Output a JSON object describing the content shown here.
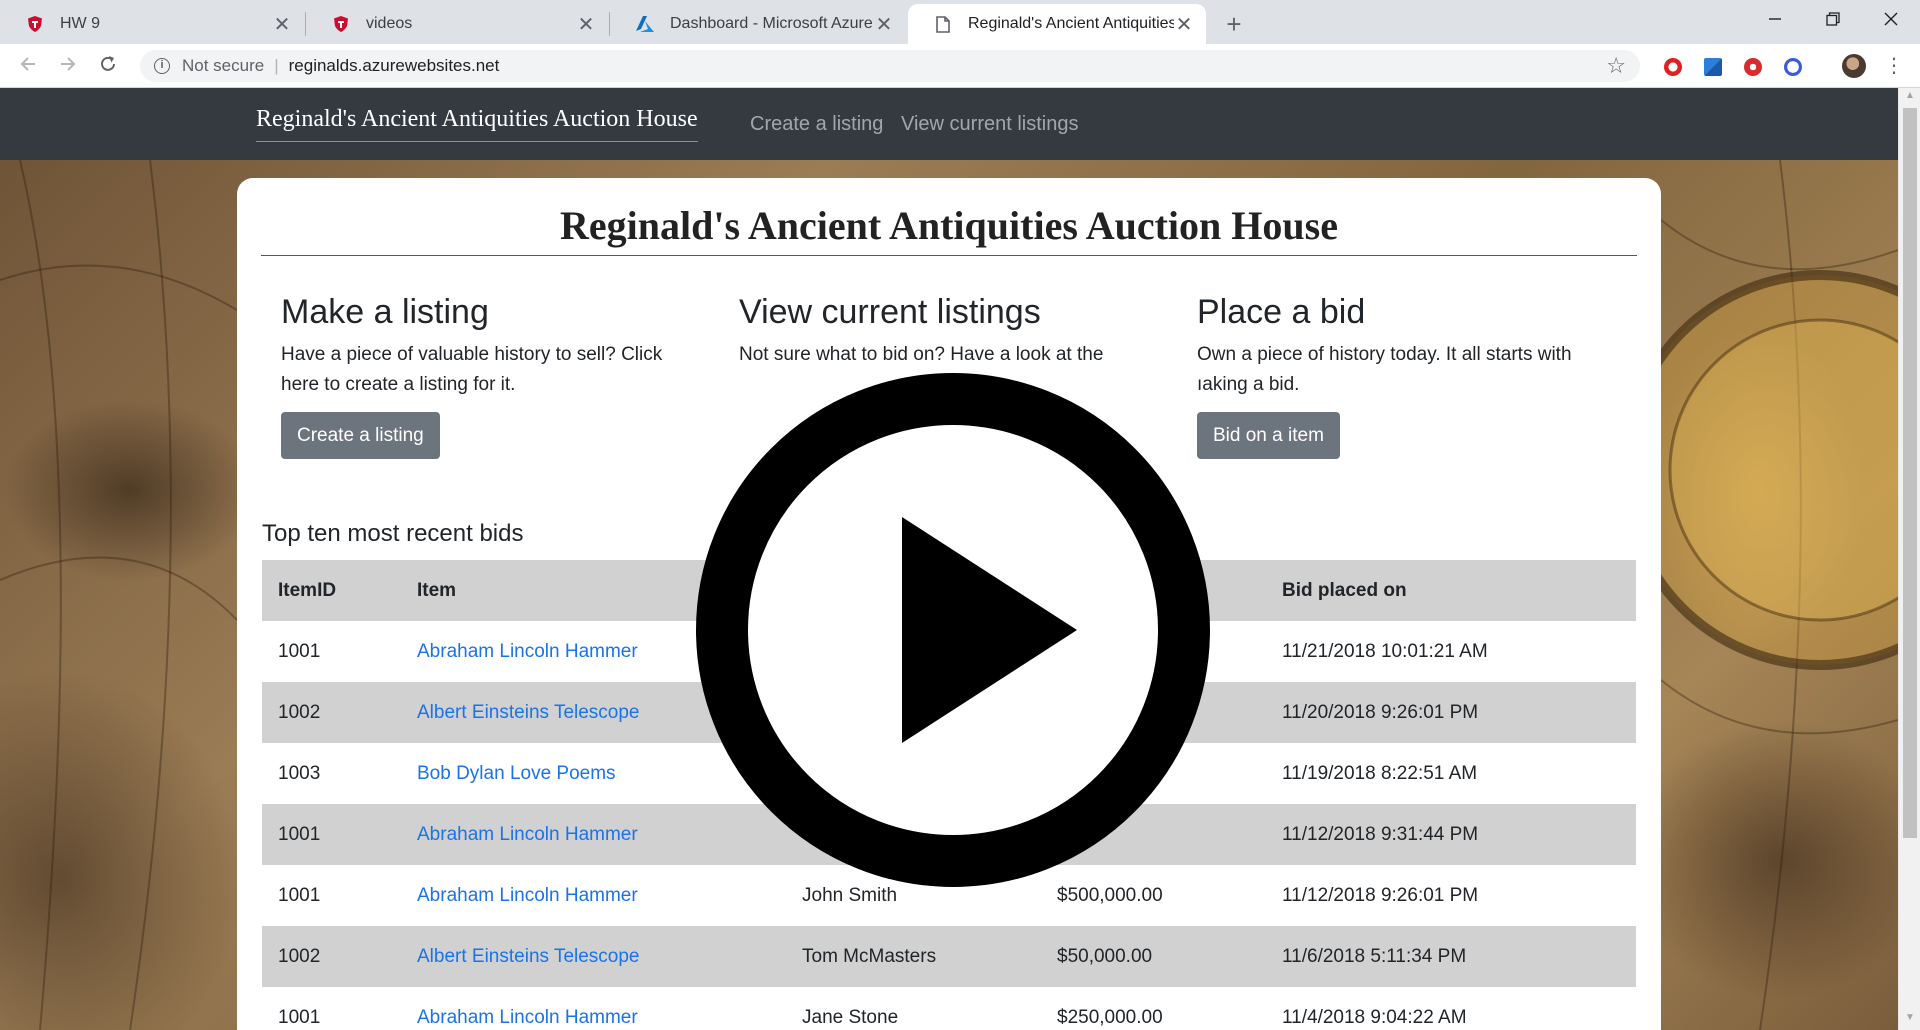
{
  "browser": {
    "tabs": [
      {
        "title": "HW 9",
        "favicon": "shield-icon",
        "active": false
      },
      {
        "title": "videos",
        "favicon": "shield-icon",
        "active": false
      },
      {
        "title": "Dashboard - Microsoft Azure",
        "favicon": "azure-icon",
        "active": false
      },
      {
        "title": "Reginald's Ancient Antiquities Au",
        "favicon": "page-icon",
        "active": true
      }
    ],
    "close_glyph": "✕",
    "new_tab_glyph": "+",
    "security_label": "Not secure",
    "url": "reginalds.azurewebsites.net"
  },
  "site": {
    "brand": "Reginald's Ancient Antiquities Auction House",
    "nav": [
      "Create a listing",
      "View current listings"
    ]
  },
  "page": {
    "title": "Reginald's Ancient Antiquities Auction House",
    "sections": [
      {
        "heading": "Make a listing",
        "text": "Have a piece of valuable history to sell? Click here to create a listing for it.",
        "button": "Create a listing"
      },
      {
        "heading": "View current listings",
        "text": "Not sure what to bid on? Have a look at the",
        "button": ""
      },
      {
        "heading": "Place a bid",
        "text": "Own a piece of history today. It all starts with ıaking a bid.",
        "button": "Bid on a item"
      }
    ],
    "table": {
      "title": "Top ten most recent bids",
      "columns": [
        "ItemID",
        "Item",
        "",
        "",
        "Bid placed on"
      ],
      "rows": [
        [
          "1001",
          "Abraham Lincoln Hammer",
          "",
          "",
          "11/21/2018 10:01:21 AM"
        ],
        [
          "1002",
          "Albert Einsteins Telescope",
          "",
          "",
          "11/20/2018 9:26:01 PM"
        ],
        [
          "1003",
          "Bob Dylan Love Poems",
          "",
          "",
          "11/19/2018 8:22:51 AM"
        ],
        [
          "1001",
          "Abraham Lincoln Hammer",
          "",
          "",
          "11/12/2018 9:31:44 PM"
        ],
        [
          "1001",
          "Abraham Lincoln Hammer",
          "John Smith",
          "$500,000.00",
          "11/12/2018 9:26:01 PM"
        ],
        [
          "1002",
          "Albert Einsteins Telescope",
          "Tom McMasters",
          "$50,000.00",
          "11/6/2018 5:11:34 PM"
        ],
        [
          "1001",
          "Abraham Lincoln Hammer",
          "Jane Stone",
          "$250,000.00",
          "11/4/2018 9:04:22 AM"
        ]
      ]
    }
  },
  "overlay": {
    "icon": "play-icon"
  },
  "colors": {
    "navbar": "#343a40",
    "button": "#6c757d",
    "link": "#1a73e8",
    "row_shade": "#d1d1d1"
  }
}
